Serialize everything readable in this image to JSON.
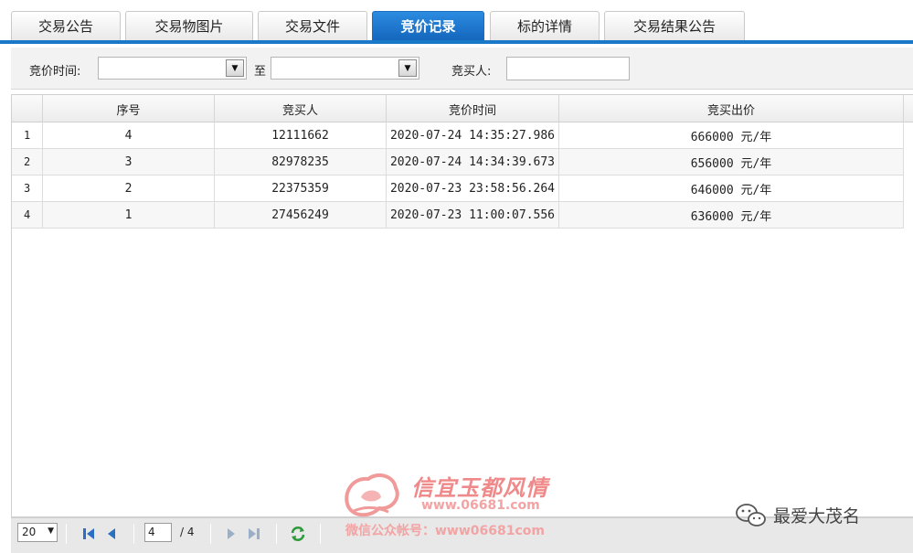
{
  "tabs": [
    {
      "label": "交易公告",
      "active": false
    },
    {
      "label": "交易物图片",
      "active": false
    },
    {
      "label": "交易文件",
      "active": false
    },
    {
      "label": "竞价记录",
      "active": true
    },
    {
      "label": "标的详情",
      "active": false
    },
    {
      "label": "交易结果公告",
      "active": false
    }
  ],
  "filter": {
    "time_label": "竞价时间:",
    "from_value": "",
    "to_label": "至",
    "to_value": "",
    "buyer_label": "竞买人:",
    "buyer_value": ""
  },
  "table": {
    "columns": [
      "序号",
      "竞买人",
      "竞价时间",
      "竞买出价"
    ],
    "rows": [
      {
        "rownum": "1",
        "seq": "4",
        "buyer": "12111662",
        "time": "2020-07-24 14:35:27.986",
        "price": "666000 元/年"
      },
      {
        "rownum": "2",
        "seq": "3",
        "buyer": "82978235",
        "time": "2020-07-24 14:34:39.673",
        "price": "656000 元/年"
      },
      {
        "rownum": "3",
        "seq": "2",
        "buyer": "22375359",
        "time": "2020-07-23 23:58:56.264",
        "price": "646000 元/年"
      },
      {
        "rownum": "4",
        "seq": "1",
        "buyer": "27456249",
        "time": "2020-07-23 11:00:07.556",
        "price": "636000 元/年"
      }
    ]
  },
  "pager": {
    "page_size": "20",
    "current_page": "4",
    "total_text": "/ 4"
  },
  "watermark": {
    "title": "信宜玉都风情",
    "url": "www.06681.com",
    "subtitle": "微信公众帐号：www06681com",
    "wechat_account": "最爱大茂名"
  },
  "colors": {
    "accent": "#1a78c8",
    "watermark": "#f08a8a",
    "pager_icon": "#2a6fc4",
    "refresh_icon": "#2e9a3a"
  },
  "icons": {
    "dropdown": "chevron-down-icon",
    "first": "first-page-icon",
    "prev": "prev-page-icon",
    "next": "next-page-icon",
    "last": "last-page-icon",
    "refresh": "refresh-icon",
    "wechat": "wechat-icon"
  }
}
